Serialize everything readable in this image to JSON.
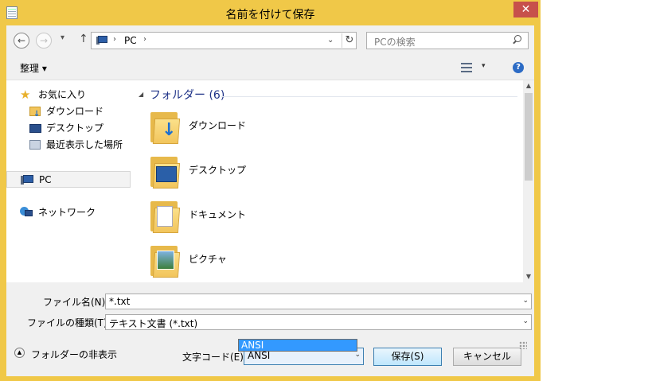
{
  "window": {
    "title": "名前を付けて保存",
    "close_glyph": "✕"
  },
  "nav": {
    "back_glyph": "←",
    "forward_glyph": "→",
    "recent_glyph": "▾",
    "up_glyph": "↑",
    "address_sep": "›",
    "address_path": "PC",
    "address_dropdown_glyph": "⌄",
    "refresh_glyph": "↻",
    "search_placeholder": "PCの検索"
  },
  "toolbar": {
    "organize_label": "整理 ▾",
    "view_dropdown_glyph": "▾",
    "help_glyph": "?"
  },
  "sidebar": {
    "favorites_label": "お気に入り",
    "items": [
      {
        "label": "ダウンロード",
        "icon": "downloads-folder-icon"
      },
      {
        "label": "デスクトップ",
        "icon": "desktop-icon"
      },
      {
        "label": "最近表示した場所",
        "icon": "recent-places-icon"
      }
    ],
    "pc_label": "PC",
    "network_label": "ネットワーク"
  },
  "content": {
    "group_header": "フォルダー (6)",
    "group_arrow": "◢",
    "folders": [
      {
        "label": "ダウンロード"
      },
      {
        "label": "デスクトップ"
      },
      {
        "label": "ドキュメント"
      },
      {
        "label": "ピクチャ"
      }
    ]
  },
  "scrollbar": {
    "up_glyph": "▲",
    "down_glyph": "▼"
  },
  "form": {
    "filename_label": "ファイル名(N):",
    "filename_value": "*.txt",
    "filetype_label": "ファイルの種類(T):",
    "filetype_value": "テキスト文書 (*.txt)",
    "encoding_label": "文字コード(E):",
    "encoding_value": "ANSI",
    "encoding_options_visible": [
      "ANSI"
    ],
    "save_button": "保存(S)",
    "cancel_button": "キャンセル",
    "hide_folders_label": "フォルダーの非表示",
    "combo_arrow": "⌄"
  },
  "colors": {
    "frame": "#f0c848",
    "close_button": "#c7504b",
    "accent_blue": "#1e3287",
    "selection": "#3399ff"
  }
}
